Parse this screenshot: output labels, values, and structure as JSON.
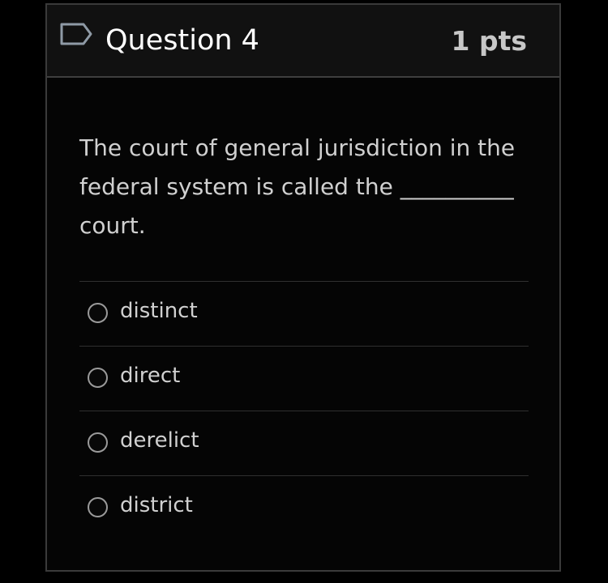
{
  "question": {
    "title": "Question 4",
    "points": "1 pts",
    "flag_icon": "flag-outline-icon",
    "text": "The court of general jurisdiction in the federal system is called the __________ court."
  },
  "answers": [
    {
      "label": "distinct"
    },
    {
      "label": "direct"
    },
    {
      "label": "derelict"
    },
    {
      "label": "district"
    }
  ],
  "colors": {
    "background": "#000000",
    "header_background": "#111111",
    "text": "#d0d0d0",
    "border": "#3a3a3a"
  }
}
